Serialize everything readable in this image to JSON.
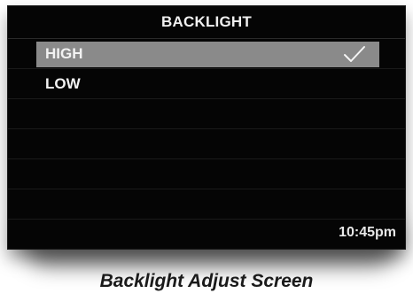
{
  "screen": {
    "title": "BACKLIGHT",
    "options": [
      {
        "label": "HIGH",
        "selected": true,
        "checked": true
      },
      {
        "label": "LOW",
        "selected": false,
        "checked": false
      }
    ],
    "empty_rows": 5,
    "time": "10:45pm",
    "check_icon": "checkmark-icon",
    "colors": {
      "background": "#050505",
      "highlight": "#8a8a8a",
      "text": "#f2f2f2"
    }
  },
  "caption": "Backlight Adjust Screen"
}
